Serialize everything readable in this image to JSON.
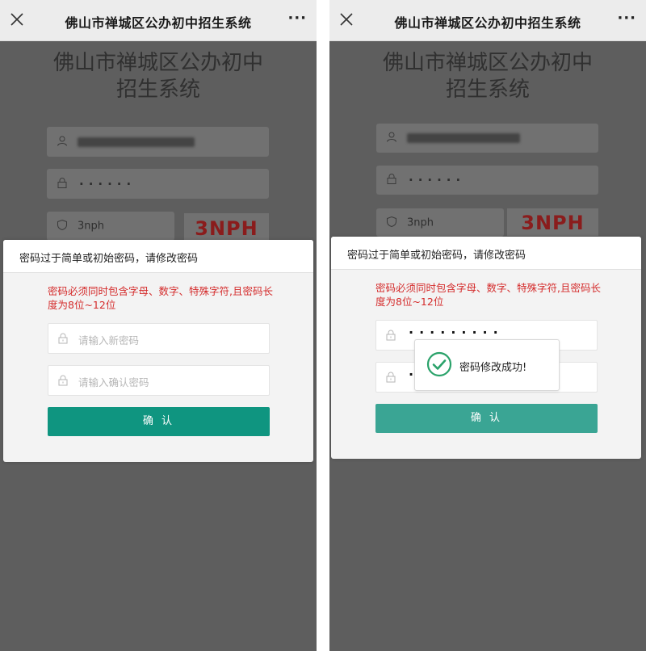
{
  "header": {
    "title": "佛山市禅城区公办初中招生系统",
    "more_label": "···"
  },
  "page_title_line1": "佛山市禅城区公办初中",
  "page_title_line2": "招生系统",
  "login": {
    "password_mask": "······",
    "captcha_input": "3nph",
    "captcha_image_text": "3NPH"
  },
  "dialog": {
    "title": "密码过于简单或初始密码，请修改密码",
    "requirement": "密码必须同时包含字母、数字、特殊字符,且密码长度为8位~12位",
    "new_password_placeholder": "请输入新密码",
    "confirm_password_placeholder": "请输入确认密码",
    "confirm_button": "确 认",
    "filled_new_password_mask": "·········",
    "filled_confirm_password_mask": "·"
  },
  "toast": {
    "message": "密码修改成功!"
  },
  "colors": {
    "confirm_button_active": "#0f9580",
    "confirm_button_faded": "#3aa594",
    "warning_text": "#d42b2b",
    "success_green": "#2aa26a"
  }
}
